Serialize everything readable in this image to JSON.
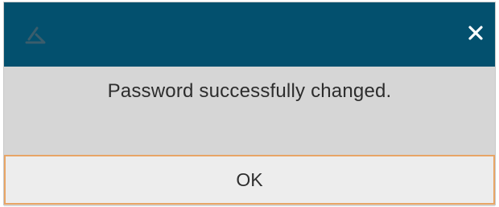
{
  "dialog": {
    "title_icon": "app-logo-icon",
    "close_icon": "close-icon",
    "message": "Password successfully changed.",
    "ok_label": "OK"
  },
  "colors": {
    "titlebar": "#03506e",
    "body": "#d6d6d6",
    "button_border": "#e8a566",
    "button_bg": "#ededed"
  }
}
